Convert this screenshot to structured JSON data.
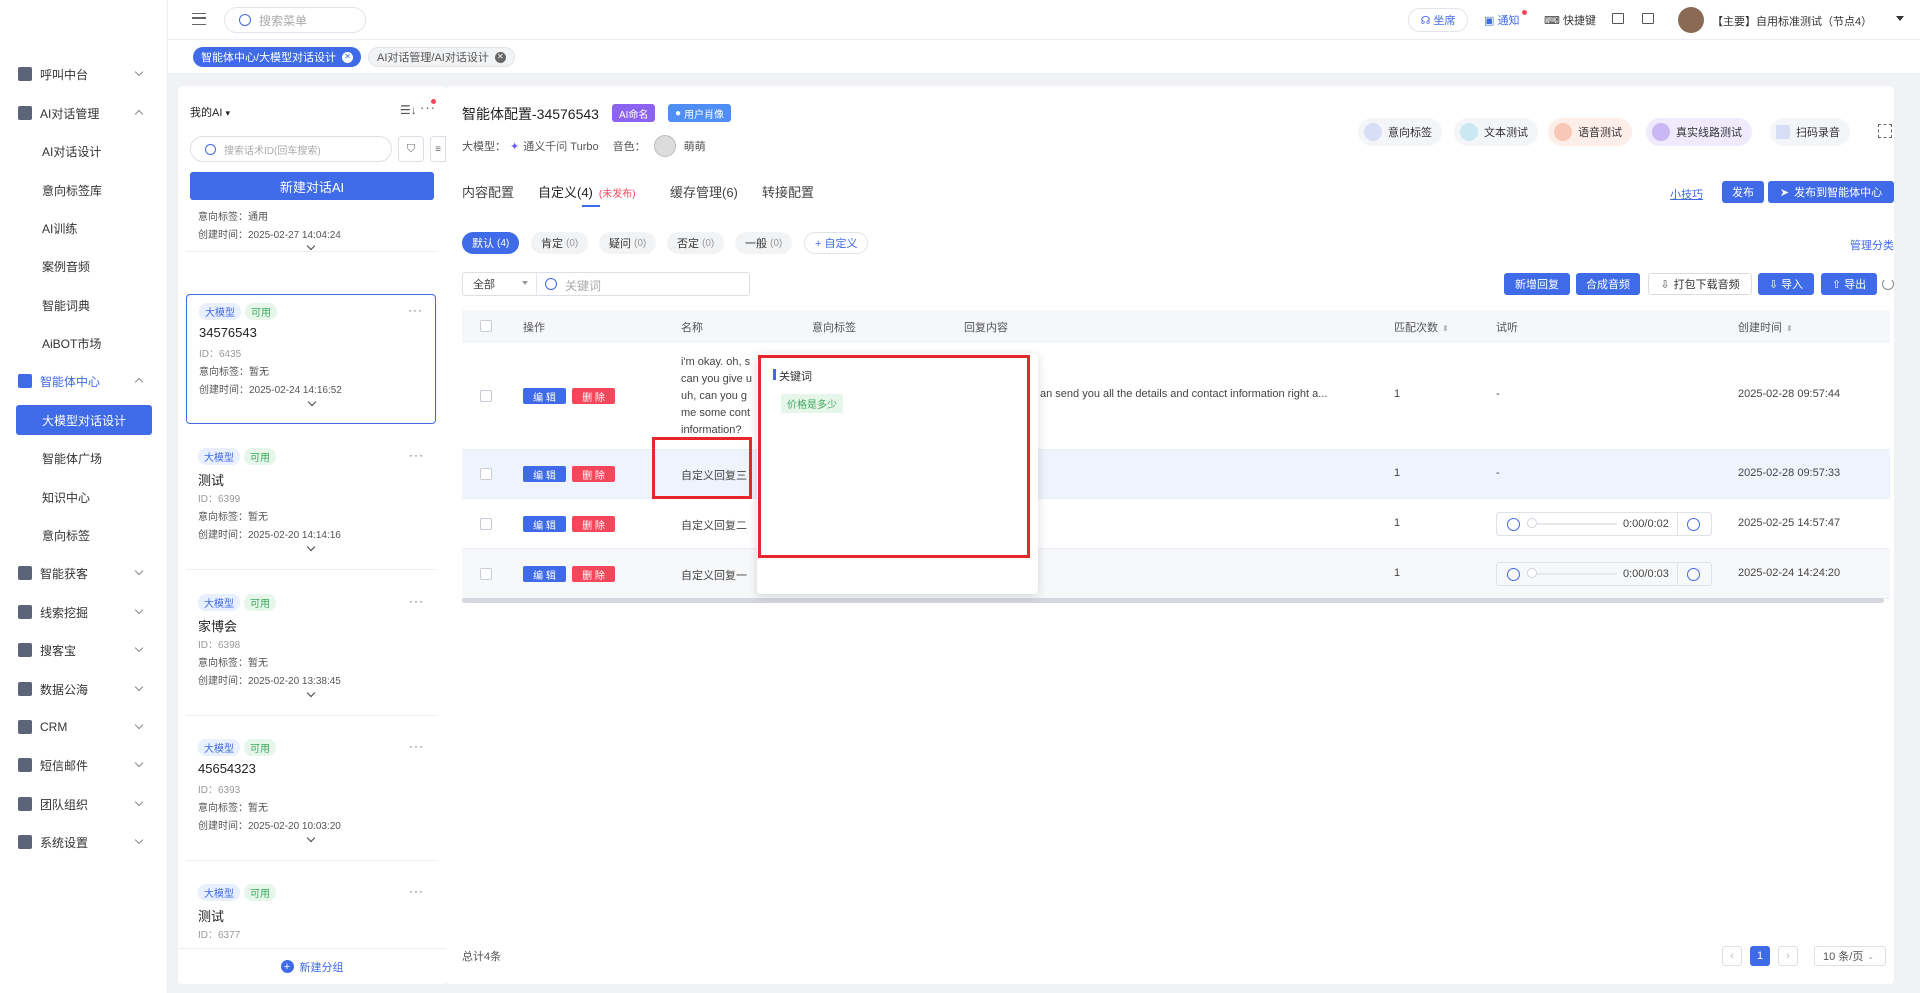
{
  "topbar": {
    "search_placeholder": "搜索菜单",
    "seat": "坐席",
    "notice": "通知",
    "shortcut": "快捷键",
    "user": "【主要】自用标准测试（节点4）"
  },
  "tabs": [
    {
      "label": "智能体中心/大模型对话设计",
      "active": true
    },
    {
      "label": "AI对话管理/AI对话设计",
      "active": false
    }
  ],
  "sidebar": {
    "menu": [
      {
        "label": "呼叫中台",
        "icon": "phone-icon"
      },
      {
        "label": "AI对话管理",
        "icon": "chat-icon",
        "expanded": true
      },
      {
        "label": "智能体中心",
        "icon": "agent-icon",
        "expanded": true
      },
      {
        "label": "智能获客",
        "icon": "target-icon"
      },
      {
        "label": "线索挖掘",
        "icon": "mine-icon"
      },
      {
        "label": "搜客宝",
        "icon": "search-icon"
      },
      {
        "label": "数据公海",
        "icon": "data-icon"
      },
      {
        "label": "CRM",
        "icon": "crm-icon"
      },
      {
        "label": "短信邮件",
        "icon": "mail-icon"
      },
      {
        "label": "团队组织",
        "icon": "team-icon"
      },
      {
        "label": "系统设置",
        "icon": "settings-icon"
      }
    ],
    "ai_sub": [
      "AI对话设计",
      "意向标签库",
      "AI训练",
      "案例音频",
      "智能词典",
      "AiBOT市场"
    ],
    "agent_sub": [
      "大模型对话设计",
      "智能体广场",
      "知识中心",
      "意向标签"
    ]
  },
  "list": {
    "title": "我的AI",
    "search_placeholder": "搜索话术ID(回车搜索)",
    "new_btn": "新建对话AI",
    "partial": {
      "tag": "意向标签：通用",
      "time": "创建时间：2025-02-27 14:04:24"
    },
    "cards": [
      {
        "name": "34576543",
        "id": "ID：6435",
        "tag": "意向标签：暂无",
        "time": "创建时间：2025-02-24 14:16:52",
        "type": "大模型",
        "status": "可用"
      },
      {
        "name": "测试",
        "id": "ID：6399",
        "tag": "意向标签：暂无",
        "time": "创建时间：2025-02-20 14:14:16",
        "type": "大模型",
        "status": "可用"
      },
      {
        "name": "家博会",
        "id": "ID：6398",
        "tag": "意向标签：暂无",
        "time": "创建时间：2025-02-20 13:38:45",
        "type": "大模型",
        "status": "可用"
      },
      {
        "name": "45654323",
        "id": "ID：6393",
        "tag": "意向标签：暂无",
        "time": "创建时间：2025-02-20 10:03:20",
        "type": "大模型",
        "status": "可用"
      },
      {
        "name": "测试",
        "id": "ID：6377",
        "tag": "",
        "time": "",
        "type": "大模型",
        "status": "可用"
      }
    ],
    "new_group": "新建分组"
  },
  "main": {
    "title": "智能体配置-34576543",
    "badge_ai": "AI命名",
    "badge_user": "用户肖像",
    "model_label": "大模型：",
    "model_value": "通义千问 Turbo",
    "voice_label": "音色：",
    "voice_value": "萌萌",
    "tools": [
      "意向标签",
      "文本测试",
      "语音测试",
      "真实线路测试",
      "扫码录音"
    ],
    "tabs": [
      {
        "label": "内容配置"
      },
      {
        "label": "自定义(4)",
        "note": "(未发布)"
      },
      {
        "label": "缓存管理(6)"
      },
      {
        "label": "转接配置"
      }
    ],
    "tips": "小技巧",
    "publish": "发布",
    "publish_center": "发布到智能体中心",
    "filters": [
      {
        "label": "默认",
        "count": "(4)"
      },
      {
        "label": "肯定",
        "count": "(0)"
      },
      {
        "label": "疑问",
        "count": "(0)"
      },
      {
        "label": "否定",
        "count": "(0)"
      },
      {
        "label": "一般",
        "count": "(0)"
      }
    ],
    "add_custom": "+ 自定义",
    "manage_cat": "管理分类",
    "select_all": "全部",
    "keyword_placeholder": "关键词",
    "actions": [
      "新增回复",
      "合成音频",
      "打包下载音频",
      "导入",
      "导出"
    ],
    "columns": [
      "操作",
      "名称",
      "意向标签",
      "回复内容",
      "匹配次数",
      "试听",
      "创建时间"
    ],
    "edit": "编 辑",
    "delete": "删 除",
    "rows": [
      {
        "name": "i'm okay. oh, s\ncan you give u\nuh, can you g\nme some cont\ninformation?",
        "reply": "an send you all the details and contact information right a...",
        "count": "1",
        "audio": "-",
        "time": "2025-02-28 09:57:44"
      },
      {
        "name": "自定义回复三",
        "reply": "",
        "count": "1",
        "audio": "-",
        "time": "2025-02-28 09:57:33"
      },
      {
        "name": "自定义回复二",
        "reply": "",
        "count": "1",
        "audio": "0:00/0:02",
        "time": "2025-02-25 14:57:47"
      },
      {
        "name": "自定义回复一",
        "reply": "",
        "count": "1",
        "audio": "0:00/0:03",
        "time": "2025-02-24 14:24:20"
      }
    ],
    "popup": {
      "title": "关键词",
      "tag": "价格是多少"
    },
    "total": "总计4条",
    "page": "1",
    "page_size": "10 条/页"
  },
  "colors": {
    "primary": "#3f6ae8",
    "danger": "#f5475c",
    "highlight": "#e8262b"
  }
}
